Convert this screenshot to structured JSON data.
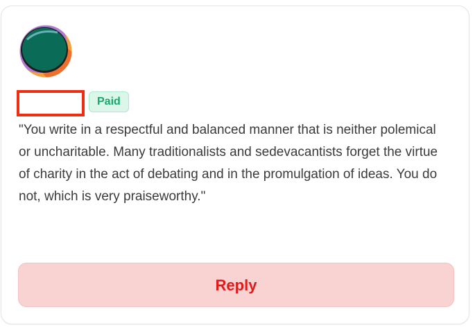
{
  "comment": {
    "badge_label": "Paid",
    "text": "\"You write in a respectful and balanced manner that is neither polemical or uncharitable. Many traditionalists and sedevacantists forget the virtue of charity in the act of debating and in the promulgation of ideas. You do not, which is very praiseworthy.\"",
    "reply_label": "Reply"
  },
  "colors": {
    "avatar_inner": "#0a6b57",
    "avatar_ring_orange": "#f2993a",
    "avatar_ring_purple": "#a48ad8",
    "redaction_box": "#ee2d12",
    "badge_bg": "#dcf6ea",
    "badge_text": "#17a86b",
    "reply_bg": "#f9d2d2",
    "reply_text": "#e01b1b"
  }
}
